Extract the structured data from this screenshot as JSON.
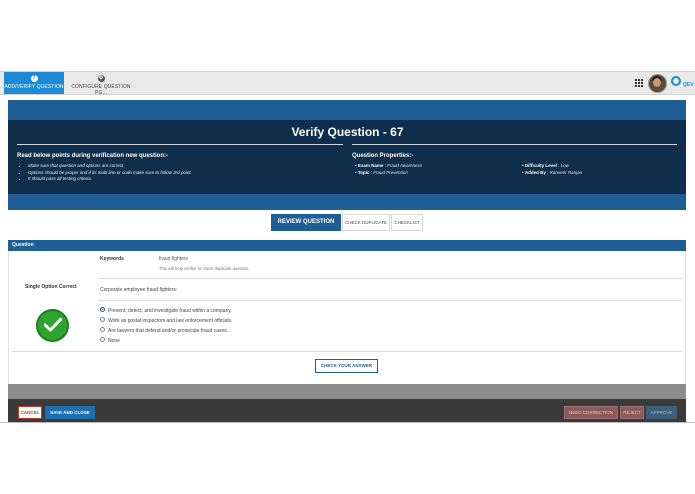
{
  "nav": {
    "tabs": [
      {
        "label": "ADD/VERIFY QUESTION",
        "icon": "question-icon",
        "icon_glyph": "?"
      },
      {
        "label": "CONFIGURE QUESTION PG...",
        "icon": "gear-icon",
        "icon_glyph": "⚙"
      }
    ],
    "logo_text": "QEV"
  },
  "page": {
    "title": "Verify Question - 67"
  },
  "guidelines": {
    "title": "Read below points during verification new question:-",
    "points": [
      "Make sure that question and options are correct.",
      "Options should be proper and if its multi line or code make sure to follow 3rd point.",
      "It should pass all testing criteria."
    ]
  },
  "properties": {
    "title": "Question Properties:-",
    "exam_name_label": "Exam Name",
    "exam_name": "Fraud Awareness",
    "topic_label": "Topic",
    "topic": "Fraud Prevention",
    "difficulty_label": "Difficulty Level",
    "difficulty": "Low",
    "added_by_label": "Added By",
    "added_by": "Ranveer Ranjan",
    "separator": ":"
  },
  "tabs": {
    "review": "REVIEW QUESTION",
    "duplicate": "CHECK DUPLICATE",
    "checklist": "CHECKLIST"
  },
  "question": {
    "header": "Question",
    "keywords_label": "Keywords",
    "keywords": "fraud fighters",
    "keywords_help": "This will help verifier to check duplicate question.",
    "type_label": "Single Option Correct",
    "text": "Corporate employee fraud fighters:",
    "options": [
      {
        "label": "Prevent, detect, and investigate fraud within a company.",
        "selected": true
      },
      {
        "label": "Work as postal inspectors and law enforcement officials.",
        "selected": false
      },
      {
        "label": "Are lawyers that defend and/or prosecute fraud cases.",
        "selected": false
      },
      {
        "label": "None",
        "selected": false
      }
    ],
    "check_answer": "CHECK YOUR ANSWER"
  },
  "footer": {
    "cancel": "CANCEL",
    "save_close": "SAVE AND CLOSE",
    "need_correction": "NEED CORRECTION",
    "reject": "REJECT",
    "approve": "APPROVE"
  },
  "colors": {
    "accent": "#1d8ad6",
    "header_dark": "#0e2e4c",
    "header_band": "#1e5e95",
    "success": "#2fa32f",
    "danger": "#c0392b"
  }
}
